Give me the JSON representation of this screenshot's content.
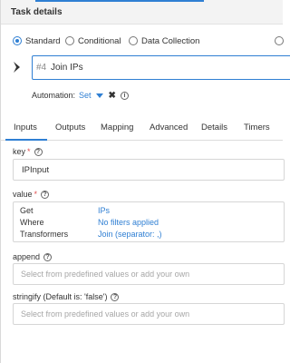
{
  "header": {
    "title": "Task details"
  },
  "task_type": {
    "options": [
      "Standard",
      "Conditional",
      "Data Collection"
    ],
    "selected": "Standard"
  },
  "task": {
    "number": "#4",
    "name": "Join IPs"
  },
  "automation": {
    "label": "Automation:",
    "value": "Set"
  },
  "tabs": [
    "Inputs",
    "Outputs",
    "Mapping",
    "Advanced",
    "Details",
    "Timers"
  ],
  "active_tab": "Inputs",
  "fields": {
    "key": {
      "label": "key",
      "required": "*",
      "value": "IPInput"
    },
    "value": {
      "label": "value",
      "required": "*",
      "rows": [
        {
          "label": "Get",
          "value": "IPs"
        },
        {
          "label": "Where",
          "value": "No filters applied"
        },
        {
          "label": "Transformers",
          "value": "Join (separator: ,)"
        }
      ]
    },
    "append": {
      "label": "append",
      "placeholder": "Select from predefined values or add your own"
    },
    "stringify": {
      "label": "stringify (Default is: 'false')",
      "placeholder": "Select from predefined values or add your own"
    }
  },
  "colors": {
    "accent": "#2f7fd3",
    "required": "#e05050",
    "placeholder": "#a6a6a6"
  }
}
